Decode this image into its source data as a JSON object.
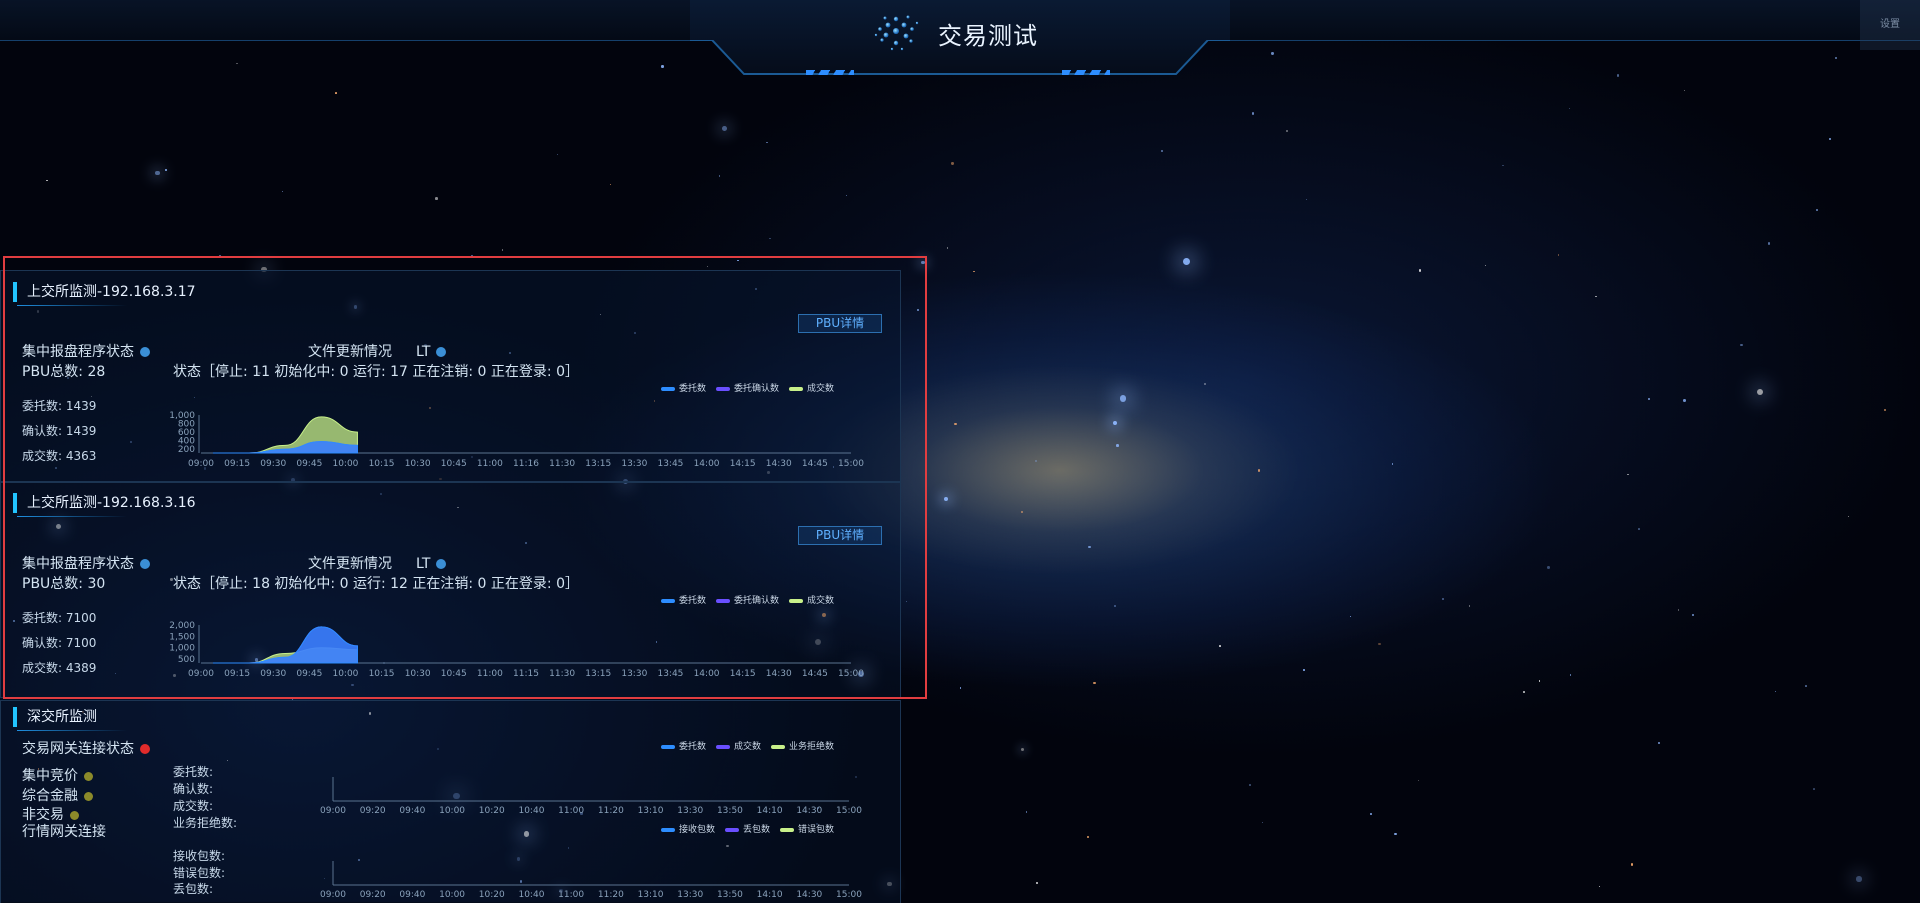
{
  "header": {
    "title": "交易测试",
    "settings_label": "设置"
  },
  "colors": {
    "accent": "#22c4ff",
    "series_entrust": "#2d8dff",
    "series_confirm": "#6a4fff",
    "series_deal": "#c8f08a",
    "status_blue": "#3b8fd6",
    "status_red": "#e12b2b",
    "status_olive": "#8c8a2a"
  },
  "times_sh": [
    "09:00",
    "09:15",
    "09:30",
    "09:45",
    "10:00",
    "10:15",
    "10:30",
    "10:45",
    "11:00",
    "11:15",
    "11:30",
    "13:15",
    "13:30",
    "13:45",
    "14:00",
    "14:15",
    "14:30",
    "14:45",
    "15:00"
  ],
  "times_sz": [
    "09:00",
    "09:20",
    "09:40",
    "10:00",
    "10:20",
    "10:40",
    "11:00",
    "11:20",
    "13:10",
    "13:30",
    "13:50",
    "14:10",
    "14:30",
    "15:00"
  ],
  "panels": [
    {
      "title": "上交所监测-192.168.3.17",
      "pbu_button": "PBU详情",
      "status_label": "集中报盘程序状态",
      "file_label": "文件更新情况",
      "lt_label": "LT",
      "pbu_total": "PBU总数:  28",
      "state": "状态［停止: 11   初始化中: 0   运行: 17   正在注销: 0   正在登录: 0］",
      "entrust": "委托数:  1439",
      "confirm": "确认数:  1439",
      "deal": "成交数:  4363",
      "legend": [
        "委托数",
        "委托确认数",
        "成交数"
      ],
      "xlabels": [
        "09:00",
        "09:15",
        "09:30",
        "09:45",
        "10:00",
        "10:15",
        "10:30",
        "10:45",
        "11:00",
        "11:16",
        "11:30",
        "13:15",
        "13:30",
        "13:45",
        "14:00",
        "14:15",
        "14:30",
        "14:45",
        "15:00"
      ],
      "yticks": [
        "1,000",
        "800",
        "600",
        "400",
        "200"
      ],
      "chart_data": {
        "type": "area",
        "x": [
          "09:00",
          "09:15",
          "09:30",
          "09:45",
          "10:00"
        ],
        "ylim": [
          0,
          1000
        ],
        "series": [
          {
            "name": "委托数",
            "values": [
              0,
              0,
              100,
              300,
              200
            ]
          },
          {
            "name": "委托确认数",
            "values": [
              0,
              0,
              100,
              300,
              200
            ]
          },
          {
            "name": "成交数",
            "values": [
              0,
              0,
              200,
              950,
              550
            ]
          }
        ]
      }
    },
    {
      "title": "上交所监测-192.168.3.16",
      "pbu_button": "PBU详情",
      "status_label": "集中报盘程序状态",
      "file_label": "文件更新情况",
      "lt_label": "LT",
      "pbu_total": "PBU总数:  30",
      "state": "状态［停止: 18   初始化中: 0   运行: 12   正在注销: 0   正在登录: 0］",
      "entrust": "委托数:  7100",
      "confirm": "确认数:  7100",
      "deal": "成交数:  4389",
      "legend": [
        "委托数",
        "委托确认数",
        "成交数"
      ],
      "xlabels": [
        "09:00",
        "09:15",
        "09:30",
        "09:45",
        "10:00",
        "10:15",
        "10:30",
        "10:45",
        "11:00",
        "11:15",
        "11:30",
        "13:15",
        "13:30",
        "13:45",
        "14:00",
        "14:15",
        "14:30",
        "14:45",
        "15:00"
      ],
      "yticks": [
        "2,000",
        "1,500",
        "1,000",
        "500"
      ],
      "chart_data": {
        "type": "area",
        "x": [
          "09:00",
          "09:15",
          "09:30",
          "09:45",
          "10:00"
        ],
        "ylim": [
          0,
          2000
        ],
        "series": [
          {
            "name": "委托数",
            "values": [
              0,
              0,
              300,
              1900,
              900
            ]
          },
          {
            "name": "委托确认数",
            "values": [
              0,
              0,
              300,
              1900,
              900
            ]
          },
          {
            "name": "成交数",
            "values": [
              0,
              0,
              500,
              800,
              700
            ]
          }
        ]
      }
    }
  ],
  "shenzhen": {
    "title": "深交所监测",
    "gateway_label": "交易网关连接状态",
    "items": [
      "集中竞价",
      "综合金融",
      "非交易"
    ],
    "market_label": "行情网关连接",
    "counts": [
      "委托数:",
      "确认数:",
      "成交数:",
      "业务拒绝数:"
    ],
    "packets": [
      "接收包数:",
      "错误包数:",
      "丢包数:"
    ],
    "legend1": [
      "委托数",
      "成交数",
      "业务拒绝数"
    ],
    "legend2": [
      "接收包数",
      "丢包数",
      "错误包数"
    ],
    "xlabels": [
      "09:00",
      "09:20",
      "09:40",
      "10:00",
      "10:20",
      "10:40",
      "11:00",
      "11:20",
      "13:10",
      "13:30",
      "13:50",
      "14:10",
      "14:30",
      "15:00"
    ]
  }
}
